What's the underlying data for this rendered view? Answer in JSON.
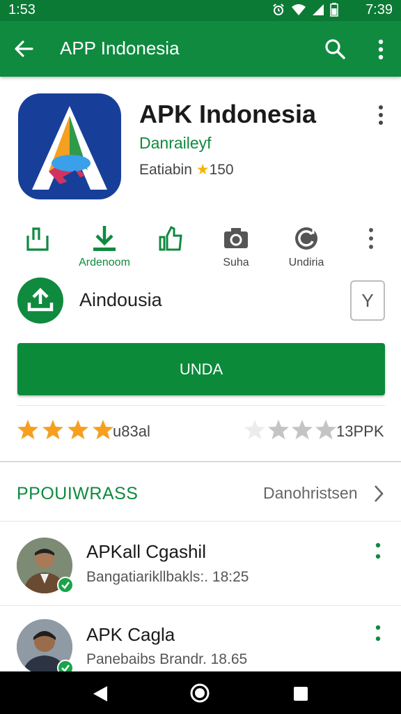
{
  "status_bar": {
    "time_left": "1:53",
    "time_right": "7:39",
    "icons": [
      "alarm-icon",
      "wifi-icon",
      "signal-icon",
      "battery-icon"
    ]
  },
  "toolbar": {
    "title": "APP Indonesia",
    "icons": [
      "back-arrow-icon",
      "search-icon",
      "more-vert-icon"
    ]
  },
  "app": {
    "name": "APK Indonesia",
    "developer": "Danraileyf",
    "rating_label": "Eatiabin",
    "rating_value": "150"
  },
  "actions": [
    {
      "label": "",
      "icon": "share-icon"
    },
    {
      "label": "Ardenoom",
      "icon": "download-icon"
    },
    {
      "label": "",
      "icon": "thumbs-up-icon"
    },
    {
      "label": "Suha",
      "icon": "camera-icon"
    },
    {
      "label": "Undiria",
      "icon": "refresh-icon"
    },
    {
      "label": "",
      "icon": "more-vert-icon"
    }
  ],
  "install": {
    "title": "Aindousia",
    "side_button": "Y",
    "button_label": "UNDA"
  },
  "ratings": {
    "left_stars": 4,
    "left_text": "u83al",
    "right_stars_filled": 3,
    "right_stars_total": 4,
    "right_text": "13PPK"
  },
  "section": {
    "title": "PPOUIWRASS",
    "link": "Danohristsen"
  },
  "reviews": [
    {
      "name": "APKall Cgashil",
      "meta": "Bangatiarikllbakls:. 18:25"
    },
    {
      "name": "APK Cagla",
      "meta": "Panebaibs Brandr. 18.65"
    }
  ],
  "colors": {
    "primary": "#0f8a3f",
    "status_bar": "#0b7a35",
    "star": "#f5a020",
    "app_icon_bg": "#173f9a"
  }
}
